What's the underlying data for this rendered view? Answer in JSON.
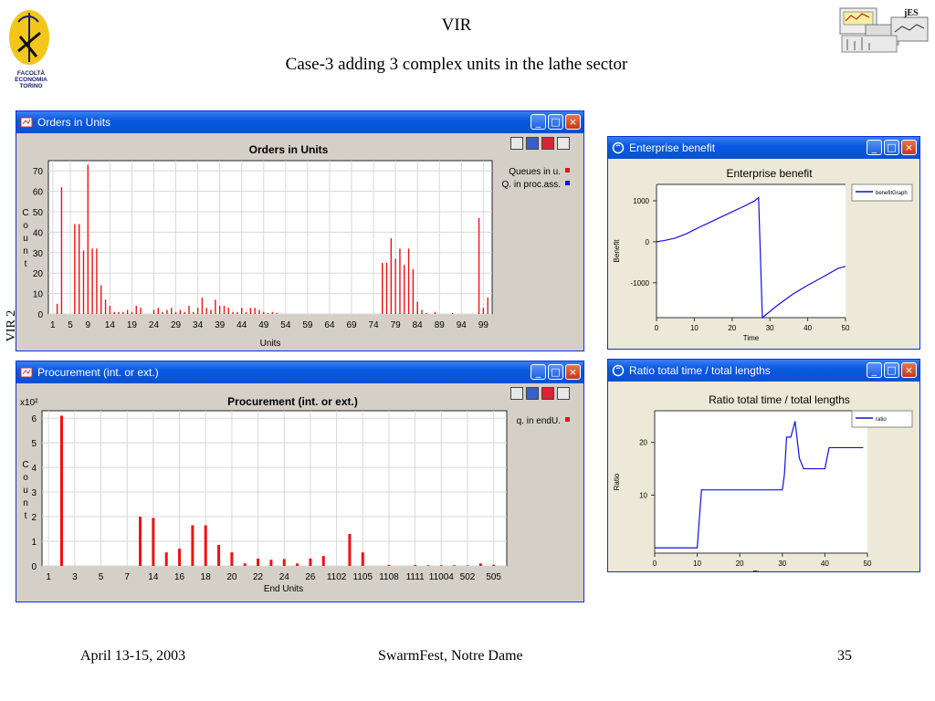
{
  "slide": {
    "title": "VIR",
    "subtitle": "Case-3 adding 3 complex units in the lathe sector",
    "side_label": "VIR 2",
    "logo_text": [
      "FACOLTÀ",
      "ECONOMIA",
      "TORINO"
    ],
    "corner_logo_text": "jES",
    "footer_left": "April 13-15, 2003",
    "footer_center": "SwarmFest, Notre Dame",
    "footer_right": "35"
  },
  "windows": {
    "orders": {
      "title": "Orders in Units"
    },
    "procurement": {
      "title": "Procurement (int. or ext.)"
    },
    "benefit": {
      "title": "Enterprise benefit"
    },
    "ratio": {
      "title": "Ratio total time / total lengths"
    }
  },
  "colors": {
    "red": "#ee1111",
    "blue": "#1111dd",
    "title_blue": "#0a5ae0"
  },
  "chart_data": [
    {
      "type": "bar",
      "title": "Orders in Units",
      "xlabel": "Units",
      "ylabel": "Count",
      "ylim": [
        0,
        75
      ],
      "yticks": [
        0,
        10,
        20,
        30,
        40,
        50,
        60,
        70
      ],
      "xlim": [
        0,
        101
      ],
      "xticks": [
        1,
        5,
        9,
        14,
        19,
        24,
        29,
        34,
        39,
        44,
        49,
        54,
        59,
        64,
        69,
        74,
        79,
        84,
        89,
        94,
        99
      ],
      "legend": [
        "Queues in u.",
        "Q. in proc.ass."
      ],
      "legend_colors": [
        "#ee1111",
        "#1111dd"
      ],
      "series": [
        {
          "name": "Queues in u.",
          "x": [
            2,
            3,
            6,
            7,
            8,
            9,
            10,
            11,
            12,
            13,
            14,
            15,
            16,
            17,
            18,
            19,
            20,
            21,
            24,
            25,
            26,
            27,
            28,
            29,
            30,
            31,
            32,
            33,
            34,
            35,
            36,
            37,
            38,
            39,
            40,
            41,
            42,
            43,
            44,
            45,
            46,
            47,
            48,
            49,
            50,
            51,
            52,
            76,
            77,
            78,
            79,
            80,
            81,
            82,
            83,
            84,
            85,
            86,
            88,
            92,
            98,
            99,
            100
          ],
          "values": [
            5,
            62,
            44,
            44,
            31,
            73,
            32,
            32,
            14,
            7,
            4,
            1,
            1,
            1,
            2,
            1,
            4,
            3,
            2,
            3,
            1,
            2,
            3,
            1,
            2,
            1,
            4,
            1,
            3,
            8,
            3,
            2,
            7,
            4,
            4,
            3,
            1,
            1,
            3,
            1,
            3,
            3,
            2,
            1,
            0.5,
            1,
            0.5,
            25,
            25,
            37,
            27,
            32,
            24,
            32,
            22,
            6,
            2,
            0.5,
            1,
            0.5,
            47,
            3,
            8
          ]
        },
        {
          "name": "Q. in proc.ass.",
          "x": [],
          "values": []
        }
      ]
    },
    {
      "type": "bar",
      "title": "Procurement (int. or ext.)",
      "xlabel": "End Units",
      "ylabel": "Count",
      "y_multiplier_label": "x10²",
      "ylim": [
        0,
        6.3
      ],
      "yticks": [
        0,
        1,
        2,
        3,
        4,
        5,
        6
      ],
      "categories": [
        "1",
        "2",
        "3",
        "4",
        "5",
        "6",
        "7",
        "13",
        "14",
        "15",
        "16",
        "17",
        "18",
        "19",
        "20",
        "21",
        "22",
        "23",
        "24",
        "25",
        "26",
        "27",
        "1102",
        "1103",
        "1105",
        "1106",
        "1108",
        "1109",
        "1111",
        "1112",
        "11004",
        "11005",
        "502",
        "503",
        "505"
      ],
      "xticks": [
        "1",
        "3",
        "5",
        "7",
        "14",
        "16",
        "18",
        "20",
        "22",
        "24",
        "26",
        "1102",
        "1105",
        "1108",
        "1111",
        "11004",
        "502",
        "505"
      ],
      "legend": [
        "q. in endU."
      ],
      "legend_colors": [
        "#ee1111"
      ],
      "series": [
        {
          "name": "q. in endU.",
          "values": [
            0,
            6.1,
            0,
            0,
            0,
            0,
            0,
            2,
            1.95,
            0.55,
            0.7,
            1.65,
            1.65,
            0.85,
            0.55,
            0.1,
            0.3,
            0.25,
            0.28,
            0.1,
            0.3,
            0.4,
            0,
            1.3,
            0.55,
            0,
            0.04,
            0,
            0.04,
            0.03,
            0.03,
            0.03,
            0.02,
            0.1,
            0.05
          ]
        }
      ]
    },
    {
      "type": "line",
      "title": "Enterprise benefit",
      "xlabel": "Time",
      "ylabel": "Benefit",
      "xlim": [
        0,
        50
      ],
      "ylim": [
        -1850,
        1400
      ],
      "xticks": [
        0,
        10,
        20,
        30,
        40,
        50
      ],
      "yticks": [
        -1000,
        0,
        1000
      ],
      "legend": [
        "benefitGraph"
      ],
      "legend_colors": [
        "#1111dd"
      ],
      "series": [
        {
          "name": "benefitGraph",
          "x": [
            0,
            2,
            5,
            8,
            11,
            14,
            17,
            20,
            23,
            26,
            27,
            28,
            32,
            36,
            40,
            44,
            48,
            50
          ],
          "values": [
            0,
            30,
            90,
            200,
            340,
            470,
            600,
            730,
            860,
            1000,
            1080,
            -1850,
            -1550,
            -1280,
            -1060,
            -860,
            -650,
            -600
          ]
        }
      ]
    },
    {
      "type": "line",
      "title": "Ratio total time / total lengths",
      "xlabel": "Time",
      "ylabel": "Ratio",
      "xlim": [
        0,
        50
      ],
      "ylim": [
        -1,
        26
      ],
      "xticks": [
        0,
        10,
        20,
        30,
        40,
        50
      ],
      "yticks": [
        10,
        20
      ],
      "legend": [
        "ratio"
      ],
      "legend_colors": [
        "#1111dd"
      ],
      "series": [
        {
          "name": "ratio",
          "x": [
            0,
            10,
            11,
            29,
            30,
            30.5,
            31,
            32,
            33,
            34,
            35,
            40,
            41,
            49
          ],
          "values": [
            0,
            0,
            11,
            11,
            11,
            14,
            21,
            21,
            24,
            17,
            15,
            15,
            19,
            19
          ]
        }
      ]
    }
  ]
}
